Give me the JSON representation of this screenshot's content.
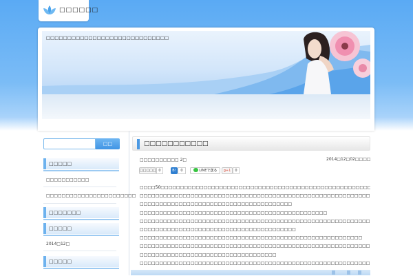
{
  "site": {
    "name": "□□□□□□"
  },
  "header": {
    "description": "□□□□□□□□□□□□□□□□□□□□□□□□□□□□□"
  },
  "search": {
    "placeholder": "",
    "button": "□□"
  },
  "sidebar": {
    "section1": {
      "title": "□□□□□",
      "items": [
        "□□□□□□□□□□□",
        "□□□□□□□□□□□□□□□□□□□□□□□"
      ]
    },
    "section2": {
      "title": "□□□□□□□"
    },
    "section3": {
      "title": "□□□□□",
      "items": [
        "2014□12□"
      ]
    },
    "section4": {
      "title": "□□□□□"
    }
  },
  "post": {
    "title": "□□□□□□□□□□□",
    "category": "□□□□□□□□□□ 2□",
    "date": "2014□12□02□□□□",
    "share": {
      "tweet": "□□□□□",
      "tweet_count": "0",
      "hatena": "B!",
      "hatena_count": "0",
      "line": "LINEで送る",
      "gplus": "g+1",
      "gplus_count": "0"
    },
    "body": [
      "□□□□50□□□□□□□□□□□□□□□□□□□□□□□□□□□□□□□□□□□□□□□□□□□□□□□□□□□□□□□□□□□□□□□",
      "□□□□□□□□□□□□□□□□□□□□□□□□□□□□□□□□□□□□□□□□□□□□□□□□□□□□□□□□□□□□□□□□□□□□□□□□□□□□□□□□□□",
      "□□□□□□□□□□□□□□□□□□□□□□□□□□□□□□□□□□□□□□□",
      "□□□□□□□□□□□□□□□□□□□□□□□□□□□□□□□□□□□□□□□□□□□□□□□□",
      "□□□□□□□□□□□□□□□□□□□□□□□□□□□□□□□□□□□□□□□□□□□□□□□□□□□□□□□□□□□□",
      "□□□□□□□□□□□□□□□□□□□□□□□□□□□□□□□□□□□□□□□□",
      "□□□□□□□□□□□□□□□□□□□□□□□□□□□□□□□□□□□□□□□□□□□□□□□□□□□□□□□□□",
      "□□□□□□□□□□□□□□□□□□□□□□□□□□□□□□□□□□□□□□□□□□□□□□□□□□□□□□□□□□□□□□□□□□□□",
      "□□□□□□□□□□□□□□□□□□□□□□□□□□□□□□□□□□□",
      "□□□□□□□□□□□□□□□□□□□□□□□□□□□□□□□□□□□□□□□□□□□□□□□□□□□□□□□□□□□□□□□□",
      "□□□□□□□□□□□□□□□□□□□□□□□□□□□□□□□□□□□□□□□□□□□□□□□□□□□□□□□□□□□□□□□□□□□□"
    ]
  },
  "colors": {
    "accent": "#4b99e3",
    "header_bg": "#5aaaf4"
  },
  "icons": [
    "lotus-logo-icon",
    "flower-icon"
  ]
}
